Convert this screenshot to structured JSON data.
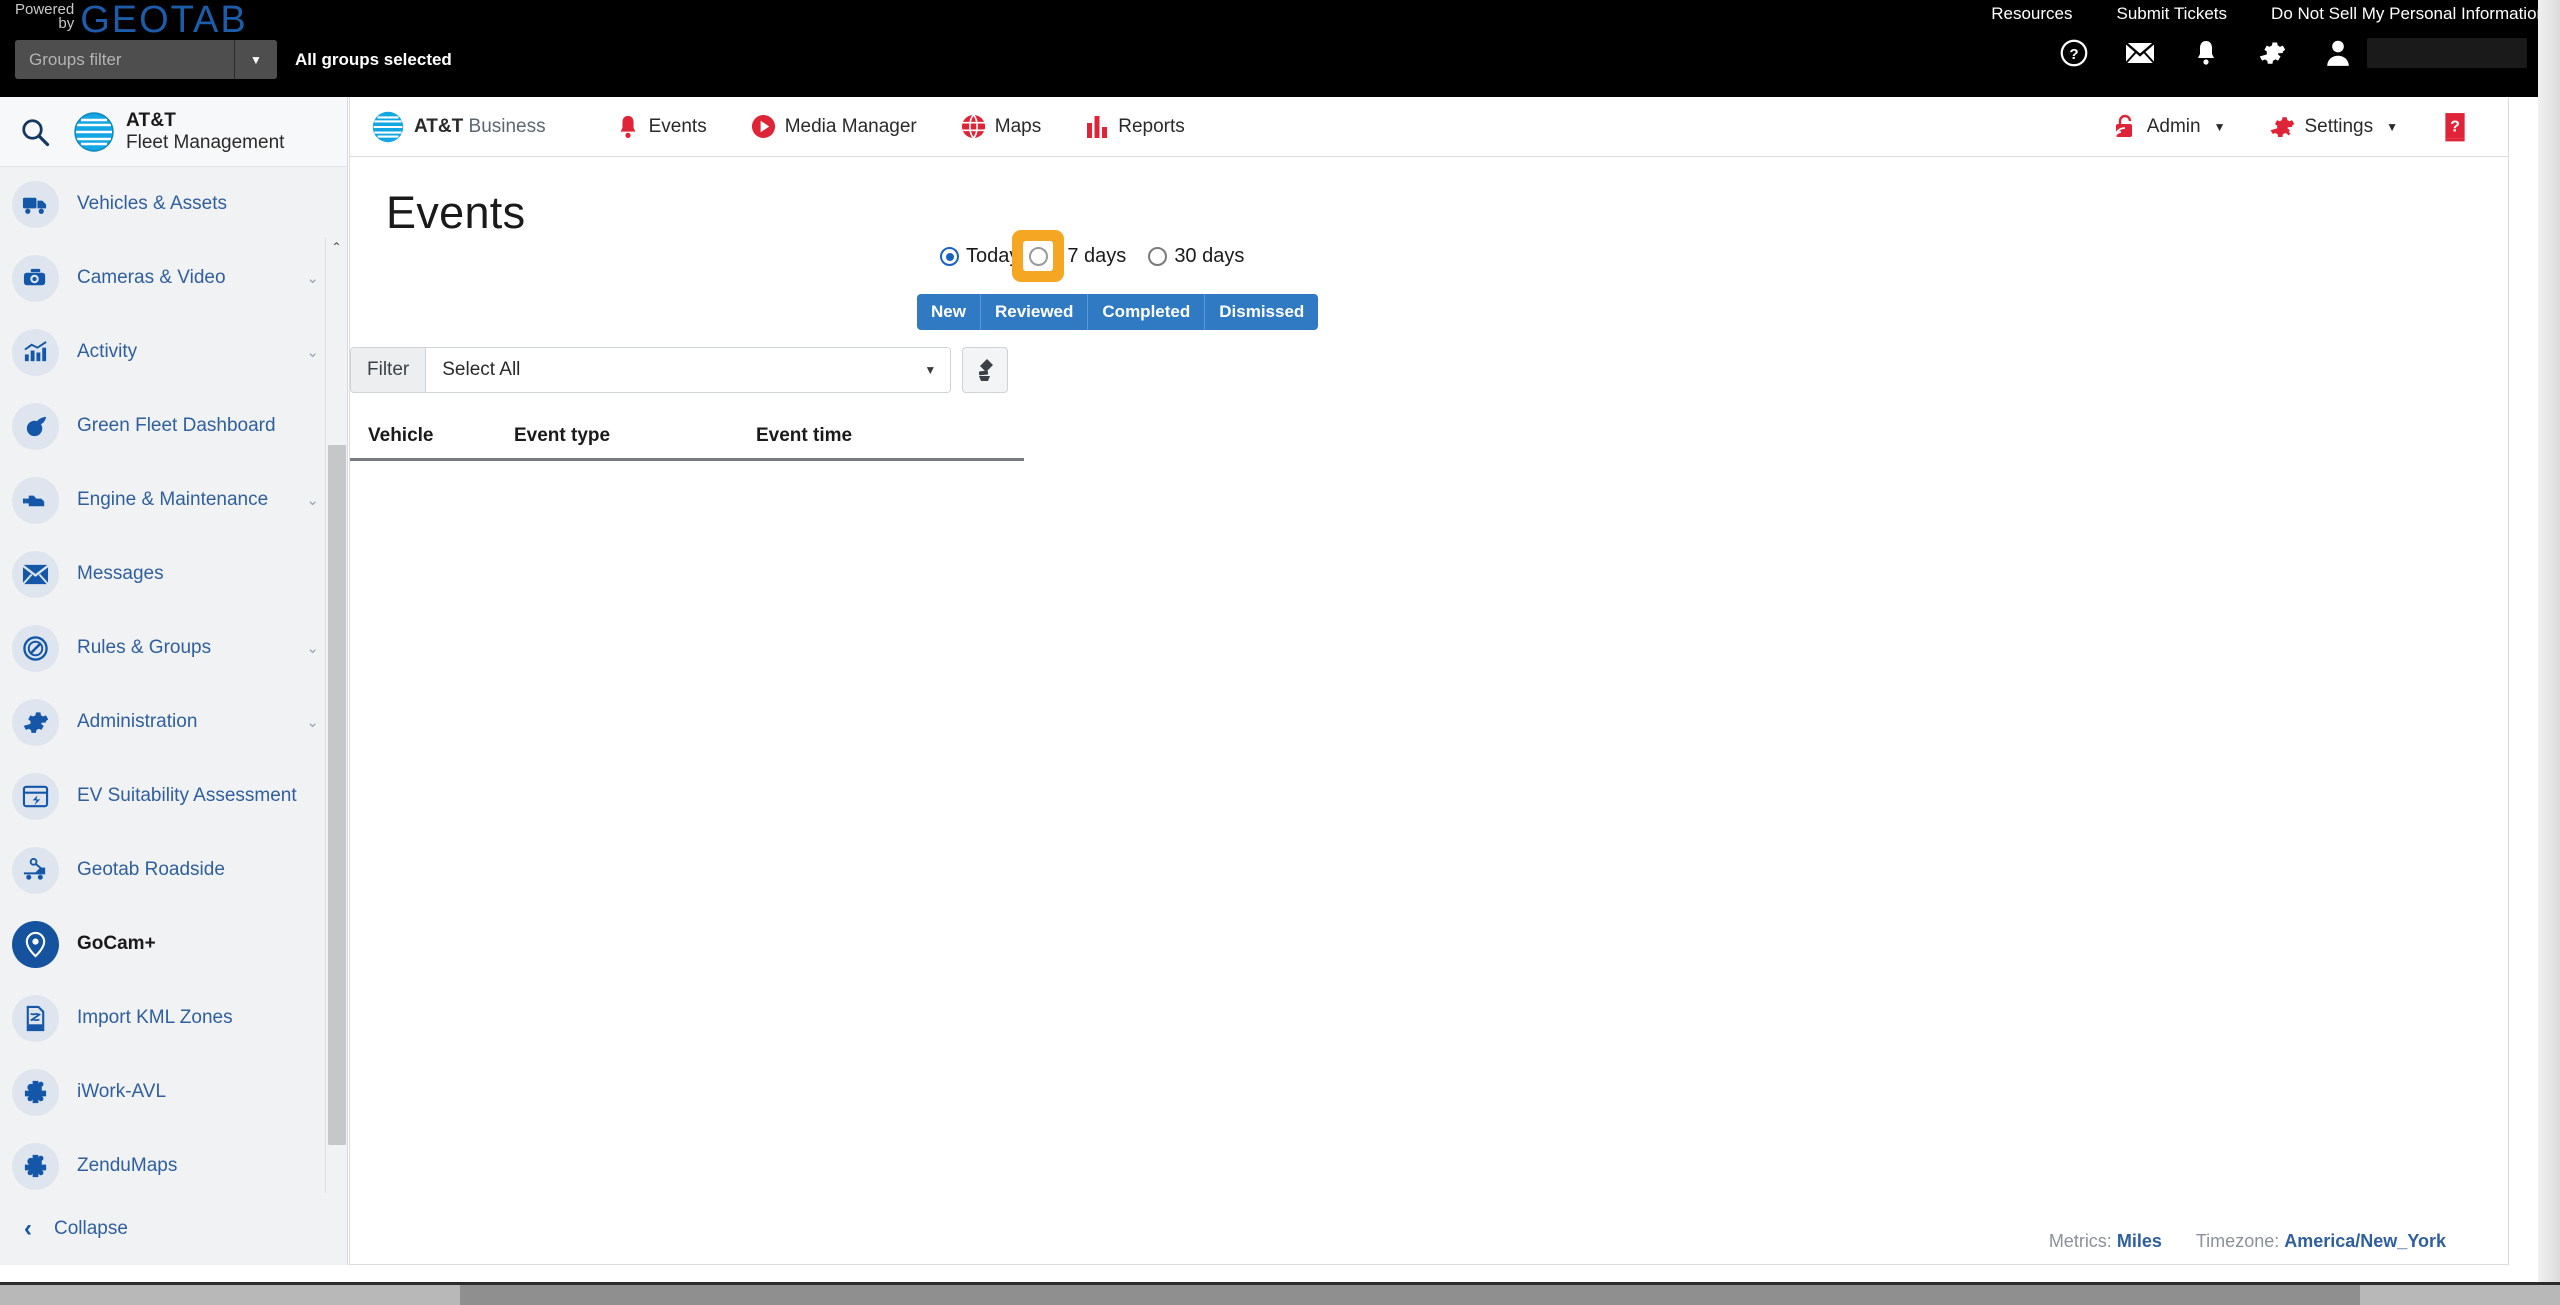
{
  "topbar": {
    "powered_line1": "Powered",
    "powered_line2": "by",
    "brand": "GEOTAB",
    "links": [
      {
        "label": "Resources"
      },
      {
        "label": "Submit Tickets"
      },
      {
        "label": "Do Not Sell My Personal Information"
      }
    ],
    "groups_filter_placeholder": "Groups filter",
    "groups_filter_value": "",
    "all_groups_selected": "All groups selected",
    "icons": [
      {
        "name": "help-icon"
      },
      {
        "name": "mail-icon"
      },
      {
        "name": "bell-icon"
      },
      {
        "name": "gear-icon"
      },
      {
        "name": "user-icon"
      }
    ]
  },
  "sidebar": {
    "search_icon": "search-icon",
    "brand_line1": "AT&T",
    "brand_line2": "Fleet Management",
    "items": [
      {
        "label": "Vehicles & Assets",
        "icon": "truck-icon",
        "expandable": false,
        "active": false
      },
      {
        "label": "Cameras & Video",
        "icon": "dashcam-icon",
        "expandable": true,
        "active": false
      },
      {
        "label": "Activity",
        "icon": "chart-icon",
        "expandable": true,
        "active": false
      },
      {
        "label": "Green Fleet Dashboard",
        "icon": "leaf-icon",
        "expandable": false,
        "active": false
      },
      {
        "label": "Engine & Maintenance",
        "icon": "engine-icon",
        "expandable": true,
        "active": false
      },
      {
        "label": "Messages",
        "icon": "envelope-icon",
        "expandable": false,
        "active": false
      },
      {
        "label": "Rules & Groups",
        "icon": "no-entry-icon",
        "expandable": true,
        "active": false
      },
      {
        "label": "Administration",
        "icon": "cog-icon",
        "expandable": true,
        "active": false
      },
      {
        "label": "EV Suitability Assessment",
        "icon": "ev-card-icon",
        "expandable": false,
        "active": false
      },
      {
        "label": "Geotab Roadside",
        "icon": "tow-truck-icon",
        "expandable": false,
        "active": false
      },
      {
        "label": "GoCam+",
        "icon": "gocam-pin-icon",
        "expandable": false,
        "active": true
      },
      {
        "label": "Import KML Zones",
        "icon": "kml-file-icon",
        "expandable": false,
        "active": false
      },
      {
        "label": "iWork-AVL",
        "icon": "puzzle-icon",
        "expandable": false,
        "active": false
      },
      {
        "label": "ZenduMaps",
        "icon": "puzzle-icon",
        "expandable": false,
        "active": false
      }
    ],
    "collapse_label": "Collapse"
  },
  "appnav": {
    "brand_bold": "AT&T",
    "brand_light": " Business",
    "items": [
      {
        "label": "Events",
        "icon": "bell-alert-icon"
      },
      {
        "label": "Media Manager",
        "icon": "play-circle-icon"
      },
      {
        "label": "Maps",
        "icon": "globe-icon"
      },
      {
        "label": "Reports",
        "icon": "bar-chart-icon"
      }
    ],
    "right_items": [
      {
        "label": "Admin",
        "icon": "lock-signal-icon",
        "caret": true
      },
      {
        "label": "Settings",
        "icon": "gear-search-icon",
        "caret": true
      }
    ],
    "help_icon": "help-book-icon"
  },
  "main": {
    "page_title": "Events",
    "date_ranges": [
      {
        "label": "Today",
        "selected": true
      },
      {
        "label": "7 days",
        "selected": false
      },
      {
        "label": "30 days",
        "selected": false
      }
    ],
    "status_tabs": [
      {
        "label": "New"
      },
      {
        "label": "Reviewed"
      },
      {
        "label": "Completed"
      },
      {
        "label": "Dismissed"
      }
    ],
    "filter": {
      "label": "Filter",
      "selected_value": "Select All",
      "clear_icon": "brush-clear-icon"
    },
    "table": {
      "columns": [
        "Vehicle",
        "Event type",
        "Event time"
      ],
      "rows": []
    }
  },
  "footer": {
    "metrics_label": "Metrics:",
    "metrics_value": "Miles",
    "timezone_label": "Timezone:",
    "timezone_value": "America/New_York"
  },
  "colors": {
    "geotab_blue": "#1c5ca8",
    "att_blue": "#0a80c4",
    "att_red": "#e02438",
    "sidebar_blue": "#2f5f9e",
    "tab_blue": "#2f7ac2",
    "highlight_orange": "#f5a623"
  }
}
